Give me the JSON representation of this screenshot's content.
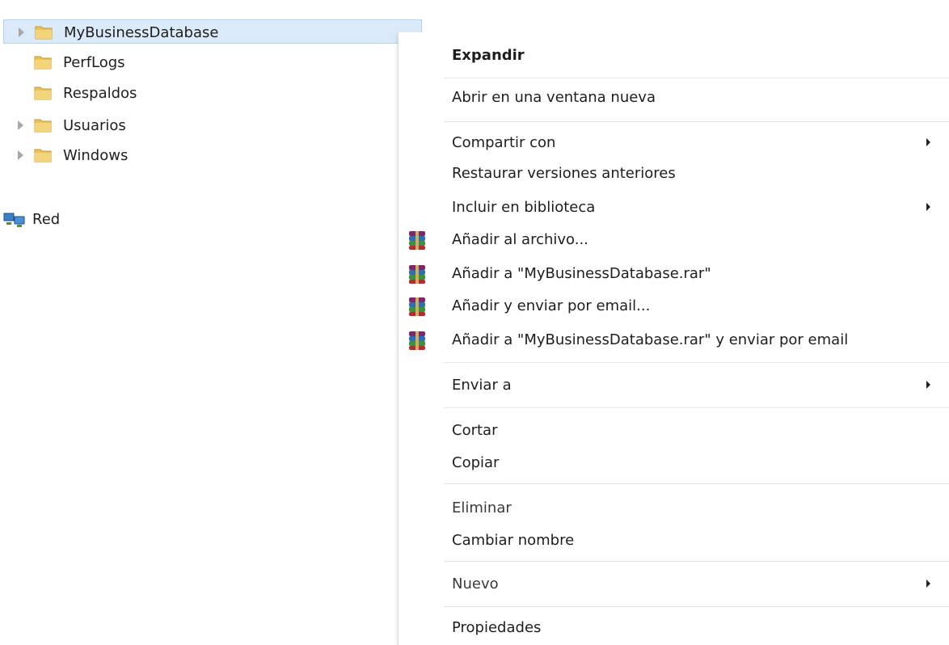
{
  "tree": {
    "items": [
      {
        "label": "MyBusinessDatabase",
        "expandable": true,
        "selected": true
      },
      {
        "label": "PerfLogs",
        "expandable": false,
        "selected": false
      },
      {
        "label": "Respaldos",
        "expandable": false,
        "selected": false
      },
      {
        "label": "Usuarios",
        "expandable": true,
        "selected": false
      },
      {
        "label": "Windows",
        "expandable": true,
        "selected": false
      }
    ],
    "network": {
      "label": "Red"
    }
  },
  "menu": {
    "items": [
      {
        "label": "Expandir",
        "bold": true
      },
      {
        "label": "Abrir en una ventana nueva"
      },
      {
        "label": "Compartir con",
        "submenu": true
      },
      {
        "label": "Restaurar versiones anteriores"
      },
      {
        "label": "Incluir en biblioteca",
        "submenu": true
      },
      {
        "label": "Añadir al archivo...",
        "icon": "winrar-icon"
      },
      {
        "label": "Añadir a \"MyBusinessDatabase.rar\"",
        "icon": "winrar-icon"
      },
      {
        "label": "Añadir y enviar por email...",
        "icon": "winrar-icon"
      },
      {
        "label": "Añadir a \"MyBusinessDatabase.rar\" y enviar por email",
        "icon": "winrar-icon"
      },
      {
        "label": "Enviar a",
        "submenu": true
      },
      {
        "label": "Cortar"
      },
      {
        "label": "Copiar"
      },
      {
        "label": "Eliminar"
      },
      {
        "label": "Cambiar nombre"
      },
      {
        "label": "Nuevo",
        "submenu": true
      },
      {
        "label": "Propiedades"
      }
    ]
  },
  "colors": {
    "selection_bg": "#dbeaf9",
    "selection_border": "#b4d2f0",
    "folder": "#e9c25a"
  }
}
